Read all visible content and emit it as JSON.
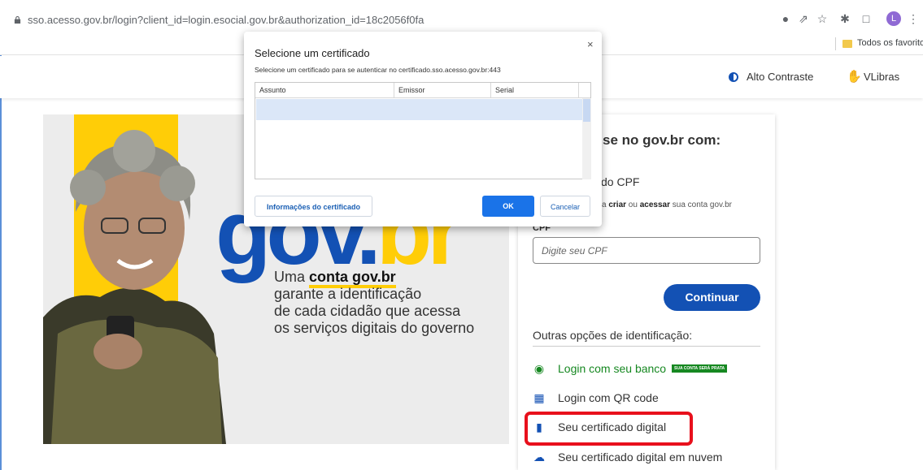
{
  "browser": {
    "url": "sso.acesso.gov.br/login?client_id=login.esocial.gov.br&authorization_id=18c2056f0fa",
    "favorites_label": "Todos os favoritos",
    "profile_initial": "L"
  },
  "header": {
    "contrast_label": "Alto Contraste",
    "vlibras_label": "VLibras"
  },
  "banner": {
    "logo_part1": "gov.",
    "logo_part2": "br",
    "tagline_prefix": "Uma ",
    "tagline_bold": "conta gov.br",
    "tagline_line2": "garante a identificação",
    "tagline_line3": "de cada cidadão que acessa",
    "tagline_line4": "os serviços digitais do governo"
  },
  "login": {
    "title": "se no gov.br com:",
    "cpf_heading": "do CPF",
    "subtitle_pre": "a ",
    "subtitle_b1": "criar",
    "subtitle_mid": " ou ",
    "subtitle_b2": "acessar",
    "subtitle_post": " sua conta gov.br",
    "cpf_label": "CPF",
    "cpf_placeholder": "Digite seu CPF",
    "continue_label": "Continuar",
    "other_options_label": "Outras opções de identificação:",
    "options": [
      {
        "label": "Login com seu banco",
        "icon": "bank-icon",
        "badge": "SUA CONTA SERÁ PRATA"
      },
      {
        "label": "Login com QR code",
        "icon": "qr-code-icon"
      },
      {
        "label": "Seu certificado digital",
        "icon": "certificate-token-icon"
      },
      {
        "label": "Seu certificado digital em nuvem",
        "icon": "cloud-icon"
      }
    ]
  },
  "dialog": {
    "title": "Selecione um certificado",
    "subtitle": "Selecione um certificado para se autenticar no certificado.sso.acesso.gov.br:443",
    "columns": [
      "Assunto",
      "Emissor",
      "Serial"
    ],
    "info_button": "Informações do certificado",
    "ok_button": "OK",
    "cancel_button": "Cancelar",
    "close_symbol": "×"
  },
  "colors": {
    "govbr_blue": "#1351b4",
    "govbr_yellow": "#ffcd07",
    "govbr_green": "#168821",
    "highlight_red": "#e8101c"
  }
}
